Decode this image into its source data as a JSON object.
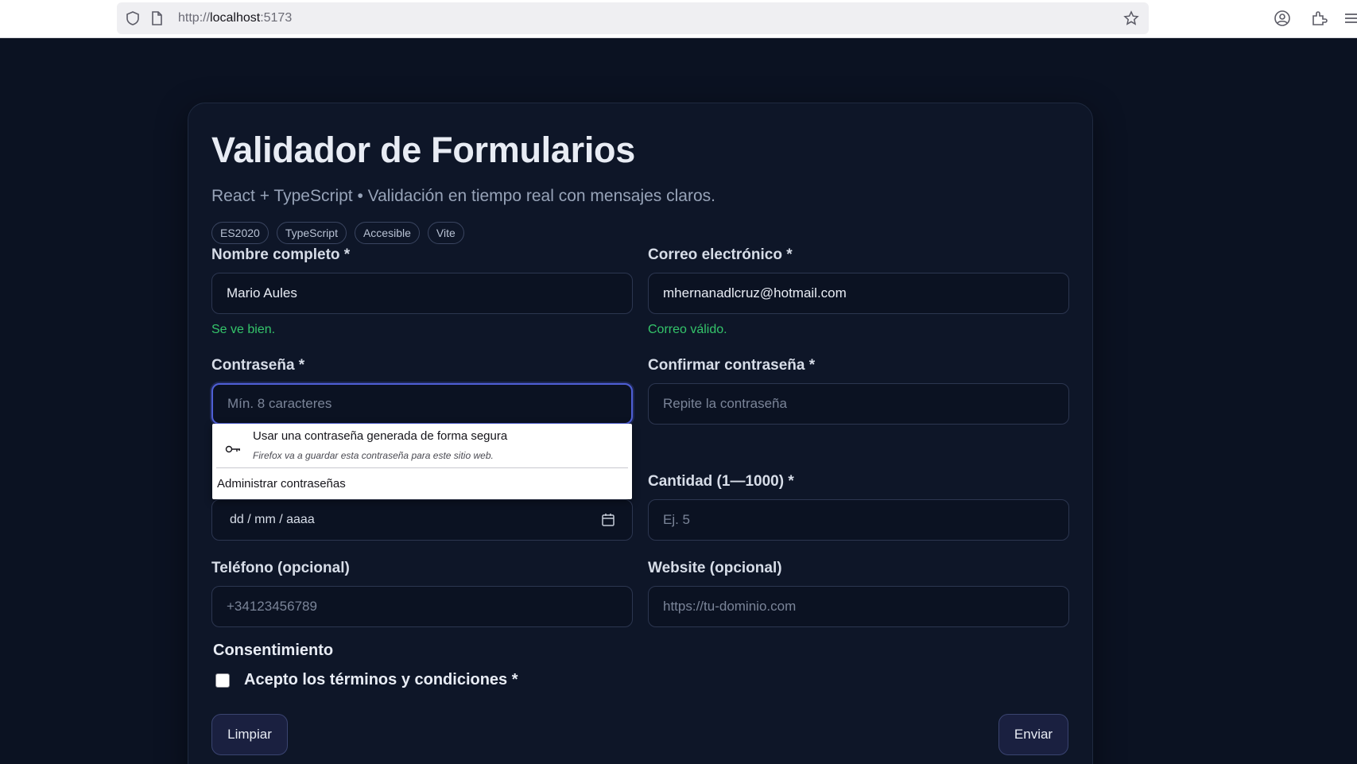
{
  "browser": {
    "url_scheme": "http://",
    "url_host": "localhost",
    "url_port": ":5173"
  },
  "header": {
    "title": "Validador de Formularios",
    "subtitle": "React + TypeScript • Validación en tiempo real con mensajes claros.",
    "tags": [
      "ES2020",
      "TypeScript",
      "Accesible",
      "Vite"
    ]
  },
  "form": {
    "name": {
      "label": "Nombre completo *",
      "value": "Mario Aules",
      "status": "Se ve bien."
    },
    "email": {
      "label": "Correo electrónico *",
      "value": "mhernanadlcruz@hotmail.com",
      "status": "Correo válido."
    },
    "password": {
      "label": "Contraseña *",
      "placeholder": "Mín. 8 caracteres"
    },
    "confirm": {
      "label": "Confirmar contraseña *",
      "placeholder": "Repite la contraseña"
    },
    "date": {
      "value": "dd / mm / aaaa"
    },
    "quantity": {
      "label": "Cantidad (1—1000) *",
      "placeholder": "Ej. 5"
    },
    "phone": {
      "label": "Teléfono (opcional)",
      "placeholder": "+34123456789"
    },
    "website": {
      "label": "Website (opcional)",
      "placeholder": "https://tu-dominio.com"
    },
    "consent": {
      "title": "Consentimiento",
      "checkbox_label": "Acepto los términos y condiciones *",
      "checked": false
    },
    "buttons": {
      "clear": "Limpiar",
      "submit": "Enviar"
    }
  },
  "password_popup": {
    "suggest": "Usar una contraseña generada de forma segura",
    "note": "Firefox va a guardar esta contraseña para este sitio web.",
    "manage": "Administrar contraseñas"
  },
  "colors": {
    "background": "#0b1222",
    "card": "#0e1628",
    "valid_text": "#34c46a",
    "focus_border": "#4f5fd6"
  }
}
